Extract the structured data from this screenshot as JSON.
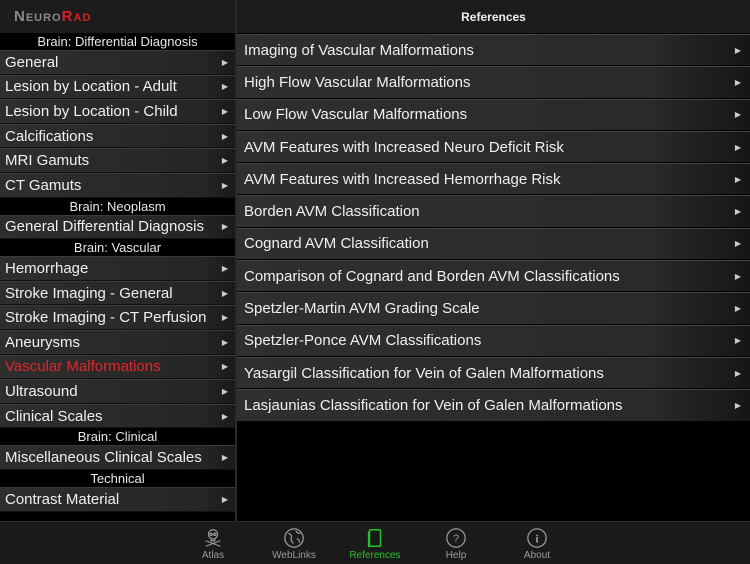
{
  "app": {
    "logo_part1": "Neuro",
    "logo_part2": "Rad"
  },
  "sidebar": {
    "sections": [
      {
        "title": "Brain: Differential Diagnosis",
        "items": [
          "General",
          "Lesion by Location - Adult",
          "Lesion by Location - Child",
          "Calcifications",
          "MRI Gamuts",
          "CT Gamuts"
        ]
      },
      {
        "title": "Brain: Neoplasm",
        "items": [
          "General Differential Diagnosis"
        ]
      },
      {
        "title": "Brain: Vascular",
        "items": [
          "Hemorrhage",
          "Stroke Imaging - General",
          "Stroke Imaging - CT Perfusion",
          "Aneurysms",
          "Vascular Malformations",
          "Ultrasound",
          "Clinical Scales"
        ]
      },
      {
        "title": "Brain: Clinical",
        "items": [
          "Miscellaneous Clinical Scales"
        ]
      },
      {
        "title": "Technical",
        "items": [
          "Contrast Material"
        ]
      }
    ],
    "active_item": "Vascular Malformations",
    "active_color": "#e0262a"
  },
  "main": {
    "title": "References",
    "items": [
      "Imaging of Vascular Malformations",
      "High Flow Vascular Malformations",
      "Low Flow Vascular Malformations",
      "AVM Features with Increased Neuro Deficit Risk",
      "AVM Features with Increased Hemorrhage Risk",
      "Borden AVM Classification",
      "Cognard AVM Classification",
      "Comparison of Cognard and Borden AVM Classifications",
      "Spetzler-Martin AVM Grading Scale",
      "Spetzler-Ponce AVM Classifications",
      "Yasargil Classification for Vein of Galen Malformations",
      "Lasjaunias Classification for Vein of Galen Malformations"
    ]
  },
  "tabbar": {
    "tabs": [
      {
        "label": "Atlas",
        "icon": "skull-crossbones-icon"
      },
      {
        "label": "WebLinks",
        "icon": "globe-icon"
      },
      {
        "label": "References",
        "icon": "book-icon"
      },
      {
        "label": "Help",
        "icon": "question-icon"
      },
      {
        "label": "About",
        "icon": "info-icon"
      }
    ],
    "active": "References",
    "active_color": "#27c22a"
  }
}
